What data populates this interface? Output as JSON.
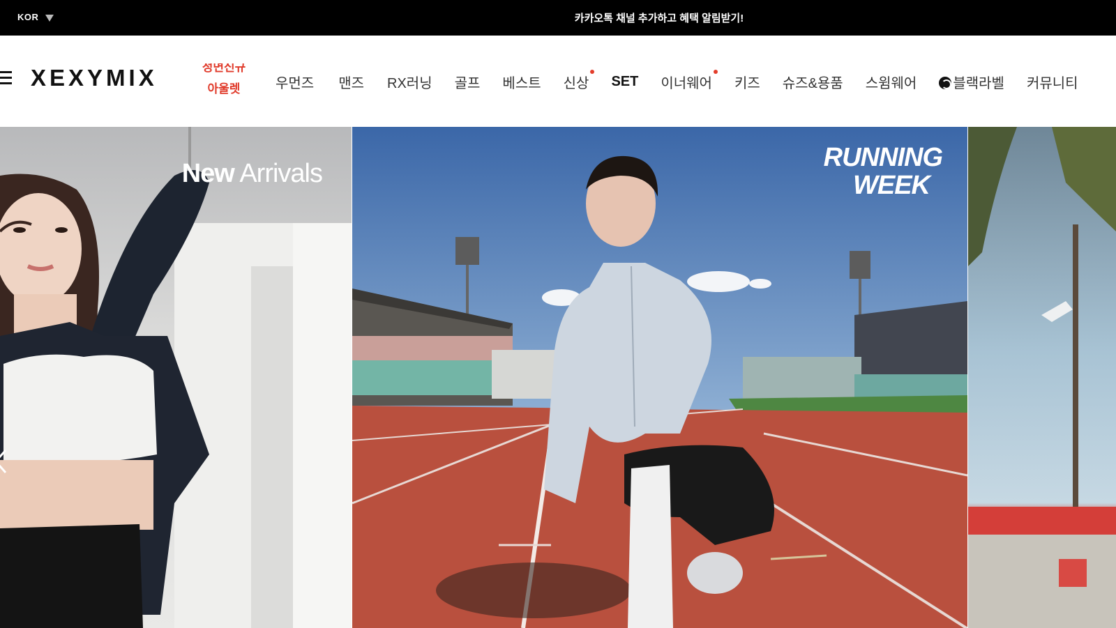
{
  "topbar": {
    "language": "KOR",
    "announcement": "카카오톡 채널 추가하고 혜택 알림받기!"
  },
  "header": {
    "logo": "XEXYMIX",
    "promo": {
      "line1": "정면신규",
      "line2": "아울렛"
    },
    "nav": [
      {
        "label": "우먼즈",
        "dot": false
      },
      {
        "label": "맨즈",
        "dot": false
      },
      {
        "label": "RX러닝",
        "dot": false
      },
      {
        "label": "골프",
        "dot": false
      },
      {
        "label": "베스트",
        "dot": false
      },
      {
        "label": "신상",
        "dot": true
      },
      {
        "label": "SET",
        "dot": false
      },
      {
        "label": "이너웨어",
        "dot": true
      },
      {
        "label": "키즈",
        "dot": false
      },
      {
        "label": "슈즈&용품",
        "dot": false
      },
      {
        "label": "스윔웨어",
        "dot": false
      },
      {
        "label": "블랙라벨",
        "dot": false,
        "icon": "globe-icon"
      },
      {
        "label": "커뮤니티",
        "dot": false
      }
    ]
  },
  "hero": {
    "slides": [
      {
        "title_bold": "New",
        "title_light": " Arrivals"
      },
      {
        "title_line1": "RUNNING",
        "title_line2": "WEEK"
      },
      {}
    ]
  },
  "colors": {
    "accent_red": "#e33d2b",
    "topbar_bg": "#000000",
    "track_red": "#b9503e"
  }
}
